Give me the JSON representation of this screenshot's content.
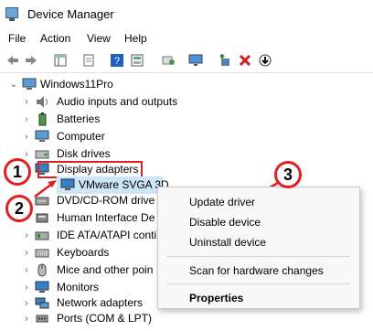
{
  "window": {
    "title": "Device Manager"
  },
  "menu": [
    "File",
    "Action",
    "View",
    "Help"
  ],
  "tree": {
    "root": "Windows11Pro",
    "items": [
      {
        "label": "Audio inputs and outputs",
        "icon": "speaker-icon"
      },
      {
        "label": "Batteries",
        "icon": "battery-icon"
      },
      {
        "label": "Computer",
        "icon": "computer-icon"
      },
      {
        "label": "Disk drives",
        "icon": "disk-icon"
      },
      {
        "label": "Display adapters",
        "icon": "monitor-icon"
      },
      {
        "label": "VMware SVGA 3D",
        "icon": "monitor-icon"
      },
      {
        "label": "DVD/CD-ROM drive",
        "icon": "dvd-icon"
      },
      {
        "label": "Human Interface De",
        "icon": "hid-icon"
      },
      {
        "label": "IDE ATA/ATAPI conti",
        "icon": "ide-icon"
      },
      {
        "label": "Keyboards",
        "icon": "keyboard-icon"
      },
      {
        "label": "Mice and other poin",
        "icon": "mouse-icon"
      },
      {
        "label": "Monitors",
        "icon": "monitor-icon"
      },
      {
        "label": "Network adapters",
        "icon": "network-icon"
      },
      {
        "label": "Ports (COM & LPT)",
        "icon": "port-icon"
      }
    ]
  },
  "context_menu": {
    "items": [
      "Update driver",
      "Disable device",
      "Uninstall device",
      "Scan for hardware changes",
      "Properties"
    ]
  },
  "annotations": [
    "1",
    "2",
    "3"
  ],
  "colors": {
    "annotation": "#e02020",
    "selection": "#cde6f7"
  }
}
